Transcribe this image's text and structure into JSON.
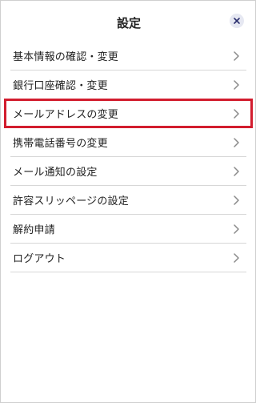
{
  "header": {
    "title": "設定",
    "close_icon": "close-icon"
  },
  "menu": {
    "items": [
      {
        "label": "基本情報の確認・変更"
      },
      {
        "label": "銀行口座確認・変更"
      },
      {
        "label": "メールアドレスの変更",
        "highlighted": true
      },
      {
        "label": "携帯電話番号の変更"
      },
      {
        "label": "メール通知の設定"
      },
      {
        "label": "許容スリッページの設定"
      },
      {
        "label": "解約申請"
      },
      {
        "label": "ログアウト"
      }
    ]
  },
  "colors": {
    "highlight": "#d21d2e",
    "close_bg": "#e6e8f2",
    "close_x": "#2b2f6e",
    "chevron": "#8a8a8a"
  }
}
